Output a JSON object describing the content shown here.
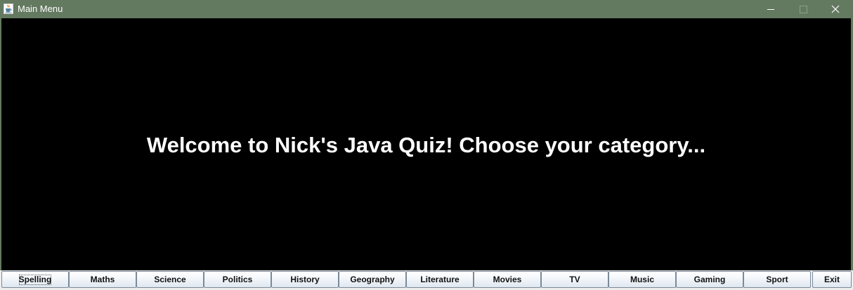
{
  "window": {
    "title": "Main Menu",
    "app_icon": "java-cup-icon",
    "controls": {
      "minimize_icon": "minimize-icon",
      "maximize_icon": "maximize-icon",
      "close_icon": "close-icon"
    },
    "titlebar_color": "#647a60"
  },
  "main": {
    "welcome_text": "Welcome to Nick's Java Quiz! Choose your category...",
    "background": "#000000",
    "text_color": "#ffffff"
  },
  "categories": {
    "buttons": [
      {
        "label": "Spelling"
      },
      {
        "label": "Maths"
      },
      {
        "label": "Science"
      },
      {
        "label": "Politics"
      },
      {
        "label": "History"
      },
      {
        "label": "Geography"
      },
      {
        "label": "Literature"
      },
      {
        "label": "Movies"
      },
      {
        "label": "TV"
      },
      {
        "label": "Music"
      },
      {
        "label": "Gaming"
      },
      {
        "label": "Sport"
      },
      {
        "label": "Exit"
      }
    ],
    "focused": "Spelling"
  }
}
